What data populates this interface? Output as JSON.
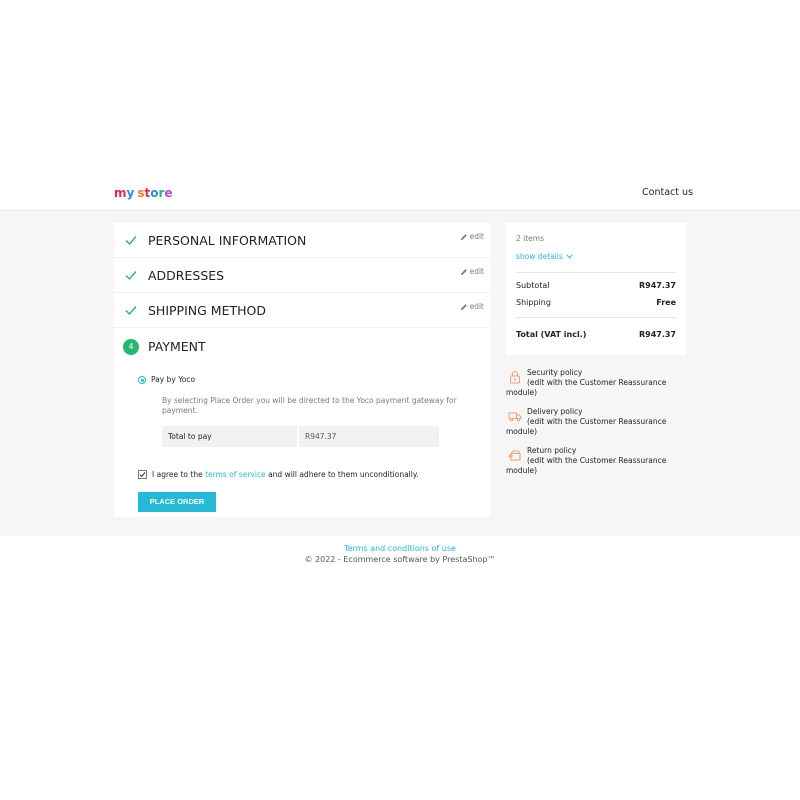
{
  "header": {
    "logo_letters": [
      "m",
      "y",
      " ",
      "s",
      "t",
      "o",
      "r",
      "e"
    ],
    "logo_colors": [
      "#e8264c",
      "#2a8de0",
      "#ffffff",
      "#ff7a1a",
      "#e8264c",
      "#2a8de0",
      "#24b76d",
      "#b34ad9"
    ],
    "contact_label": "Contact us"
  },
  "steps": [
    {
      "title": "PERSONAL INFORMATION",
      "edit_label": "edit",
      "status": "complete"
    },
    {
      "title": "ADDRESSES",
      "edit_label": "edit",
      "status": "complete"
    },
    {
      "title": "SHIPPING METHOD",
      "edit_label": "edit",
      "status": "complete"
    }
  ],
  "payment": {
    "step_number": "4",
    "title": "PAYMENT",
    "option_label": "Pay by Yoco",
    "option_selected": true,
    "description": "By selecting Place Order you will be directed to the Yoco payment gateway for payment.",
    "total_label": "Total to pay",
    "total_value": "R947.37",
    "agree_prefix": "I agree to the ",
    "agree_link": "terms of service",
    "agree_suffix": " and will adhere to them unconditionally.",
    "agree_checked": true,
    "place_order_label": "PLACE ORDER"
  },
  "summary": {
    "items_count": "2 items",
    "show_details": "show details",
    "subtotal_label": "Subtotal",
    "subtotal_value": "R947.37",
    "shipping_label": "Shipping",
    "shipping_value": "Free",
    "total_label": "Total (VAT incl.)",
    "total_value": "R947.37"
  },
  "reassurance": [
    {
      "icon": "security-lock-icon",
      "title": "Security policy",
      "subtitle": "(edit with the Customer Reassurance module)"
    },
    {
      "icon": "delivery-truck-icon",
      "title": "Delivery policy",
      "subtitle": "(edit with the Customer Reassurance module)"
    },
    {
      "icon": "return-box-icon",
      "title": "Return policy",
      "subtitle": "(edit with the Customer Reassurance module)"
    }
  ],
  "footer": {
    "link": "Terms and conditions of use",
    "copyright": "© 2022 - Ecommerce software by PrestaShop™"
  },
  "colors": {
    "accent": "#24b9d7",
    "success": "#24b76d",
    "reassure_icon": "#f39d72"
  }
}
